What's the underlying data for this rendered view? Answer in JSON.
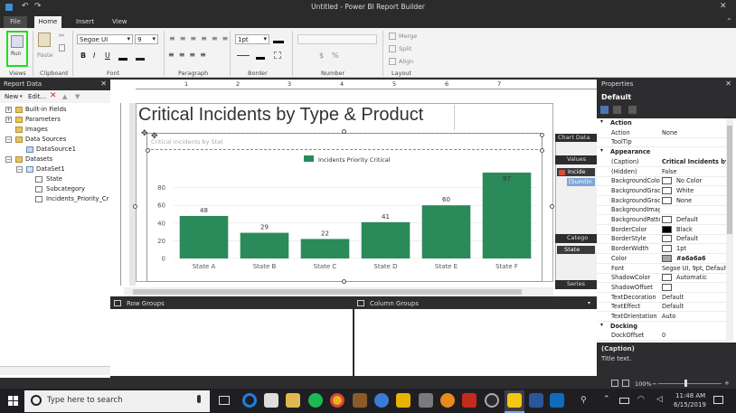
{
  "window": {
    "title": "Untitled - Power BI Report Builder"
  },
  "tabs": [
    {
      "label": "File"
    },
    {
      "label": "Home"
    },
    {
      "label": "Insert"
    },
    {
      "label": "View"
    }
  ],
  "ribbon": {
    "groups": [
      "Views",
      "Clipboard",
      "Font",
      "Paragraph",
      "Border",
      "Number",
      "Layout"
    ],
    "run_label": "Run",
    "paste_label": "Paste",
    "font_family": "Segoe UI",
    "font_size": "9",
    "border_width": "1pt",
    "bold": "B",
    "italic": "I",
    "underline": "U",
    "merge_label": "Merge",
    "split_label": "Split",
    "align_label": "Align",
    "num_symbols": [
      "$",
      "%"
    ]
  },
  "report_data": {
    "title": "Report Data",
    "new_label": "New",
    "edit_label": "Edit...",
    "items": [
      {
        "label": "Built-in Fields"
      },
      {
        "label": "Parameters"
      },
      {
        "label": "Images"
      },
      {
        "label": "Data Sources"
      },
      {
        "label": "DataSource1"
      },
      {
        "label": "Datasets"
      },
      {
        "label": "DataSet1"
      },
      {
        "label": "State"
      },
      {
        "label": "Subcategory"
      },
      {
        "label": "Incidents_Priority_Critical"
      }
    ]
  },
  "ruler": {
    "marks": [
      "1",
      "2",
      "3",
      "4",
      "5",
      "6",
      "7"
    ]
  },
  "report": {
    "title": "Critical Incidents by Type & Product",
    "chart_placeholder": "Critical Incidents by Stat"
  },
  "chart_data": {
    "type": "bar",
    "categories": [
      "State A",
      "State B",
      "State C",
      "State D",
      "State E",
      "State F"
    ],
    "series": [
      {
        "name": "Incidents Priority Critical",
        "values": [
          48,
          29,
          22,
          41,
          60,
          97
        ],
        "color": "#2b8a5a"
      }
    ],
    "ylim": [
      0,
      100
    ],
    "yticks": [
      0,
      20,
      40,
      60,
      80
    ],
    "legend": "top"
  },
  "chart_side": {
    "title": "Chart Data",
    "values_label": "Values",
    "value_item": "Incide",
    "value_expr": "[Sum(In",
    "categ_label": "Catego",
    "categ_item": "State",
    "series_label": "Series"
  },
  "groups": {
    "row_label": "Row Groups",
    "col_label": "Column Groups"
  },
  "properties": {
    "title": "Properties",
    "selected": "Default",
    "rows": [
      {
        "type": "cat",
        "name": "Action"
      },
      {
        "name": "Action",
        "value": "None"
      },
      {
        "name": "ToolTip",
        "value": ""
      },
      {
        "type": "cat",
        "name": "Appearance"
      },
      {
        "name": "(Caption)",
        "value": "Critical Incidents by St",
        "bold": true
      },
      {
        "name": "(Hidden)",
        "value": "False"
      },
      {
        "name": "BackgroundColor",
        "value": "No Color",
        "swatch": "#ffffff"
      },
      {
        "name": "BackgroundGrad",
        "value": "White",
        "swatch": "#ffffff"
      },
      {
        "name": "BackgroundGrad",
        "value": "None",
        "swatch": "#ffffff"
      },
      {
        "name": "BackgroundImag",
        "value": ""
      },
      {
        "name": "BackgroundPatte",
        "value": "Default",
        "swatch": "#ffffff"
      },
      {
        "name": "BorderColor",
        "value": "Black",
        "swatch": "#000000"
      },
      {
        "name": "BorderStyle",
        "value": "Default",
        "swatch": "#ffffff"
      },
      {
        "name": "BorderWidth",
        "value": "1pt",
        "swatch": "#ffffff"
      },
      {
        "name": "Color",
        "value": "#a6a6a6",
        "swatch": "#a6a6a6",
        "bold": true
      },
      {
        "name": "Font",
        "value": "Segoe UI, 9pt, Default"
      },
      {
        "name": "ShadowColor",
        "value": "Automatic",
        "swatch": "#ffffff"
      },
      {
        "name": "ShadowOffset",
        "value": "",
        "swatch": "#ffffff"
      },
      {
        "name": "TextDecoration",
        "value": "Default"
      },
      {
        "name": "TextEffect",
        "value": "Default"
      },
      {
        "name": "TextOrientation",
        "value": "Auto"
      },
      {
        "type": "cat",
        "name": "Docking"
      },
      {
        "name": "DockOffset",
        "value": "0"
      }
    ],
    "caption_title": "(Caption)",
    "caption_desc": "Title text."
  },
  "status": {
    "zoom": "100%"
  },
  "taskbar": {
    "search_placeholder": "Type here to search",
    "time": "11:48 AM",
    "date": "6/15/2019"
  }
}
